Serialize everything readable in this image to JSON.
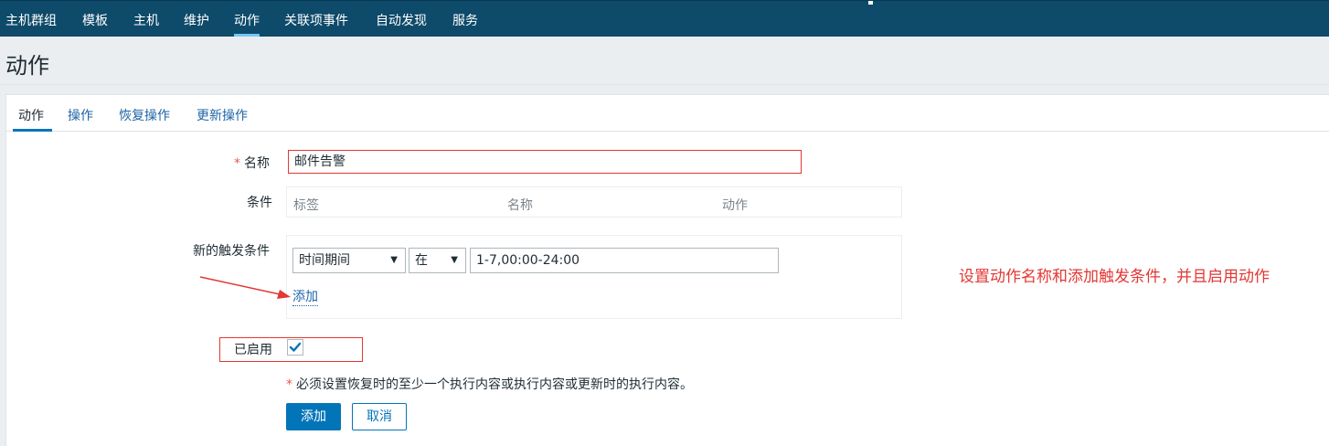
{
  "topnav": {
    "items": [
      {
        "label": "主机群组"
      },
      {
        "label": "模板"
      },
      {
        "label": "主机"
      },
      {
        "label": "维护"
      },
      {
        "label": "动作",
        "active": true
      },
      {
        "label": "关联项事件"
      },
      {
        "label": "自动发现"
      },
      {
        "label": "服务"
      }
    ]
  },
  "page": {
    "title": "动作"
  },
  "tabs": [
    {
      "label": "动作",
      "active": true
    },
    {
      "label": "操作"
    },
    {
      "label": "恢复操作"
    },
    {
      "label": "更新操作"
    }
  ],
  "form": {
    "name_label": "名称",
    "name_value": "邮件告警",
    "conditions_label": "条件",
    "conditions_columns": [
      "标签",
      "名称",
      "动作"
    ],
    "new_trigger_label": "新的触发条件",
    "trigger_type": "时间期间",
    "trigger_operator": "在",
    "trigger_value": "1-7,00:00-24:00",
    "add_link": "添加",
    "enabled_label": "已启用",
    "enabled_checked": true,
    "required_note": "必须设置恢复时的至少一个执行内容或执行内容或更新时的执行内容。",
    "add_button": "添加",
    "cancel_button": "取消"
  },
  "annotation": {
    "text": "设置动作名称和添加触发条件，并且启用动作",
    "color": "#e33734"
  },
  "colors": {
    "nav_bg": "#0e4a6a",
    "accent": "#0275b8",
    "link": "#1f65a6"
  }
}
